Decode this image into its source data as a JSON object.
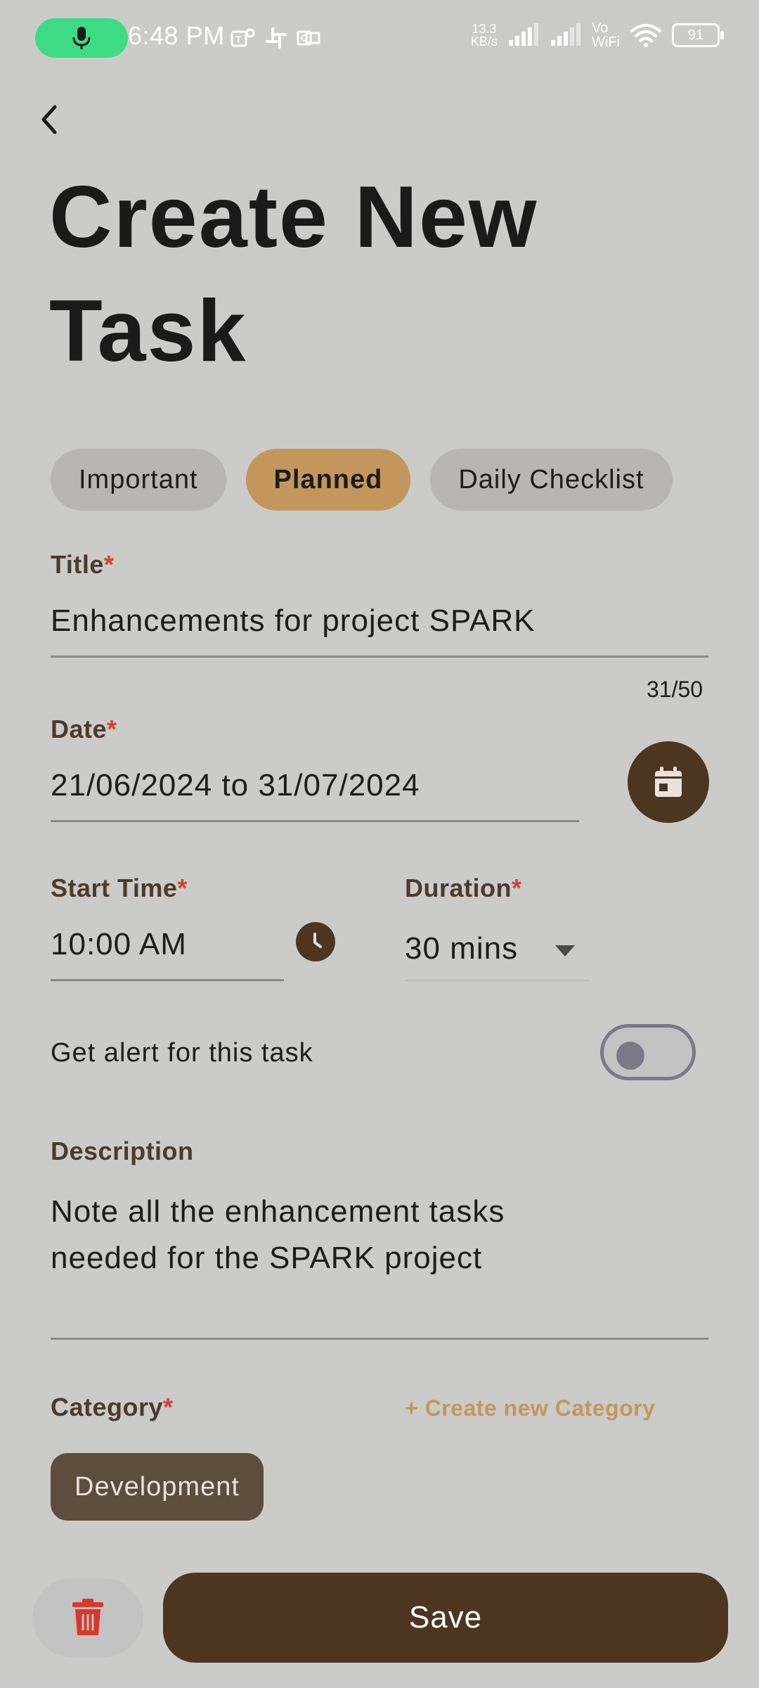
{
  "status_bar": {
    "time": "6:48 PM",
    "network_speed": "13.3",
    "network_unit": "KB/s",
    "volte_top": "Vo",
    "volte_bottom": "WiFi",
    "battery": "91",
    "icons": [
      "mic-icon",
      "teams-icon",
      "slack-icon",
      "outlook-icon",
      "signal-icon",
      "signal-icon",
      "wifi-icon",
      "battery-icon"
    ]
  },
  "page": {
    "title": "Create New Task"
  },
  "tabs": [
    {
      "label": "Important",
      "active": false
    },
    {
      "label": "Planned",
      "active": true
    },
    {
      "label": "Daily Checklist",
      "active": false
    }
  ],
  "form": {
    "title_label": "Title",
    "title_value": "Enhancements for project SPARK",
    "title_counter": "31/50",
    "date_label": "Date",
    "date_value": "21/06/2024  to  31/07/2024",
    "start_time_label": "Start Time",
    "start_time_value": "10:00 AM",
    "duration_label": "Duration",
    "duration_value": "30 mins",
    "alert_label": "Get alert for this task",
    "alert_enabled": false,
    "description_label": "Description",
    "description_line1": "Note all the enhancement tasks",
    "description_line2": "needed for the SPARK project",
    "category_label": "Category",
    "create_category": "+ Create new Category",
    "categories": [
      "Development"
    ],
    "required_mark": "*"
  },
  "actions": {
    "save_label": "Save"
  },
  "colors": {
    "background": "#cbcbca",
    "accent": "#c3975c",
    "primary_dark": "#4c3620",
    "required": "#d4432e",
    "delete": "#d9372b"
  }
}
